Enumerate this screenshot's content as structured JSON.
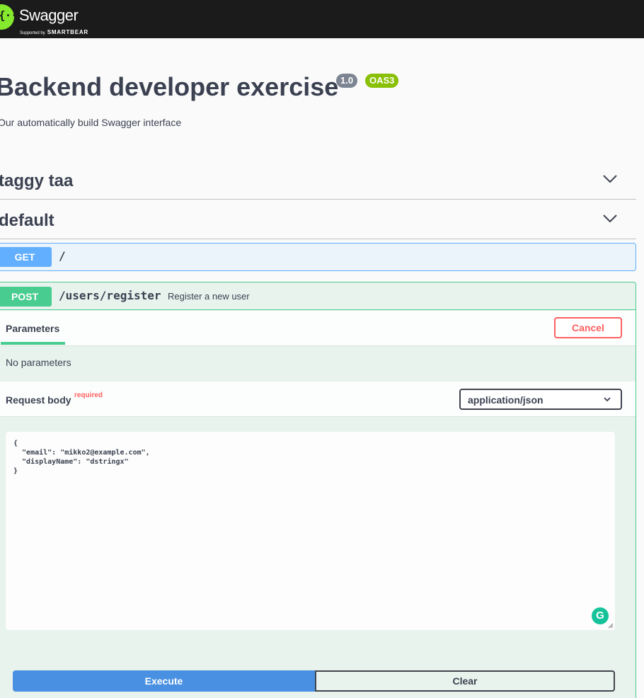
{
  "topbar": {
    "logo_glyph": "{···}",
    "logo_name": "Swagger",
    "logo_tagline": "Supported by",
    "logo_brand": "SMARTBEAR"
  },
  "info": {
    "title": "Backend developer exercise",
    "version": "1.0",
    "oas": "OAS3",
    "description": "Our automatically build Swagger interface"
  },
  "tags": [
    {
      "name": "taggy taa"
    },
    {
      "name": "default"
    }
  ],
  "operations": {
    "get": {
      "method": "GET",
      "path": "/"
    },
    "post": {
      "method": "POST",
      "path": "/users/register",
      "summary": "Register a new user",
      "parameters_tab": "Parameters",
      "cancel_label": "Cancel",
      "no_parameters": "No parameters",
      "request_body_label": "Request body",
      "required_label": "required",
      "content_type": "application/json",
      "body": "{\n  \"email\": \"mikko2@example.com\",\n  \"displayName\": \"dstringx\"\n}",
      "execute_label": "Execute",
      "clear_label": "Clear"
    }
  },
  "grammarly_glyph": "G",
  "colors": {
    "topbar": "#1b1b1b",
    "swagger_green": "#85ea2d",
    "get": "#61affe",
    "post": "#49cc90",
    "cancel": "#ff6060",
    "execute": "#4990e2"
  }
}
